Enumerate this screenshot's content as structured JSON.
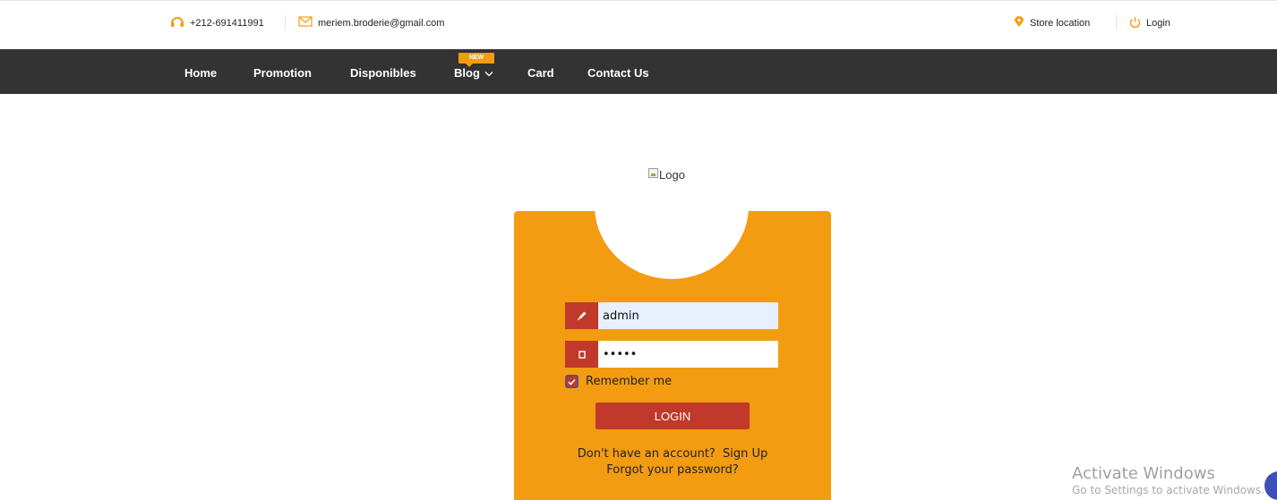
{
  "topbar": {
    "phone": "+212-691411991",
    "email": "meriem.broderie@gmail.com",
    "store_location": "Store location",
    "login": "Login"
  },
  "nav": {
    "items": [
      "Home",
      "Promotion",
      "Disponibles",
      "Blog",
      "Card",
      "Contact Us"
    ],
    "blog_badge": "NEW"
  },
  "logo": {
    "alt": "Logo"
  },
  "form": {
    "username": "admin",
    "password": "admin",
    "remember_label": "Remember me",
    "remember_checked": true,
    "login_button": "LOGIN",
    "signup_prompt": "Don't have an account?",
    "signup_link": "Sign Up",
    "forgot": "Forgot your password?"
  },
  "watermark": {
    "title": "Activate Windows",
    "subtitle": "Go to Settings to activate Windows."
  },
  "colors": {
    "accent": "#f39c12",
    "danger": "#c0392b",
    "nav_bg": "#333333"
  },
  "icons": {
    "phone": "headset-icon",
    "email": "envelope-icon",
    "store": "map-pin-icon",
    "login": "power-icon",
    "blog_dropdown": "chevron-down-icon",
    "user": "pencil-icon",
    "pass": "lock-icon",
    "check": "check-icon"
  }
}
